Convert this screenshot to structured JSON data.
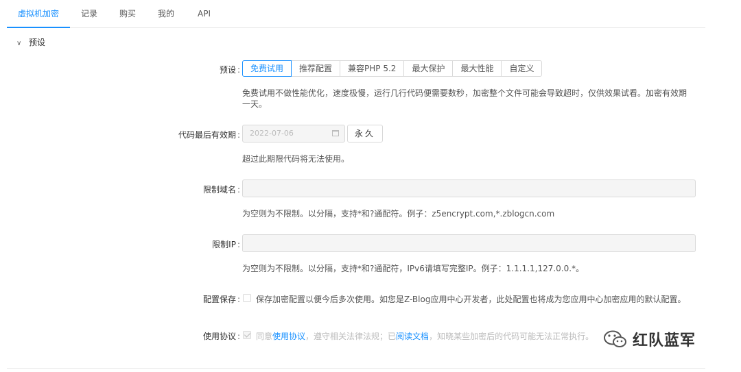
{
  "tabs": [
    {
      "label": "虚拟机加密",
      "active": true
    },
    {
      "label": "记录",
      "active": false
    },
    {
      "label": "购买",
      "active": false
    },
    {
      "label": "我的",
      "active": false
    },
    {
      "label": "API",
      "active": false
    }
  ],
  "panel": {
    "title": "预设",
    "icon": "chevron-down-icon"
  },
  "colon": ":",
  "form": {
    "preset": {
      "label": "预设",
      "options": [
        "免费试用",
        "推荐配置",
        "兼容PHP 5.2",
        "最大保护",
        "最大性能",
        "自定义"
      ],
      "selected": "免费试用",
      "help": "免费试用不做性能优化，速度极慢，运行几行代码便需要数秒，加密整个文件可能会导致超时，仅供效果试看。加密有效期一天。"
    },
    "expiry": {
      "label": "代码最后有效期",
      "value": "2022-07-06",
      "forever_label": "永久",
      "help": "超过此期限代码将无法使用。"
    },
    "domain": {
      "label": "限制域名",
      "value": "",
      "help": "为空则为不限制。以分隔，支持*和?通配符。例子：z5encrypt.com,*.zblogcn.com"
    },
    "ip": {
      "label": "限制IP",
      "value": "",
      "help": "为空则为不限制。以分隔，支持*和?通配符，IPv6请填写完整IP。例子：1.1.1.1,127.0.0.*。"
    },
    "save": {
      "label": "配置保存",
      "checked": false,
      "text": "保存加密配置以便今后多次使用。如您是Z-Blog应用中心开发者，此处配置也将成为您应用中心加密应用的默认配置。"
    },
    "agreement": {
      "label": "使用协议",
      "checked": true,
      "text_prefix": "同意",
      "link1": "使用协议",
      "text_mid": "，遵守相关法律法规；已",
      "link2": "阅读文档",
      "text_suffix": "，知晓某些加密后的代码可能无法正常执行。"
    }
  },
  "watermark": {
    "text": "红队蓝军",
    "icon": "wechat-icon"
  },
  "colors": {
    "accent": "#1890ff",
    "border": "#d9d9d9",
    "disabled_bg": "#f5f5f5"
  }
}
